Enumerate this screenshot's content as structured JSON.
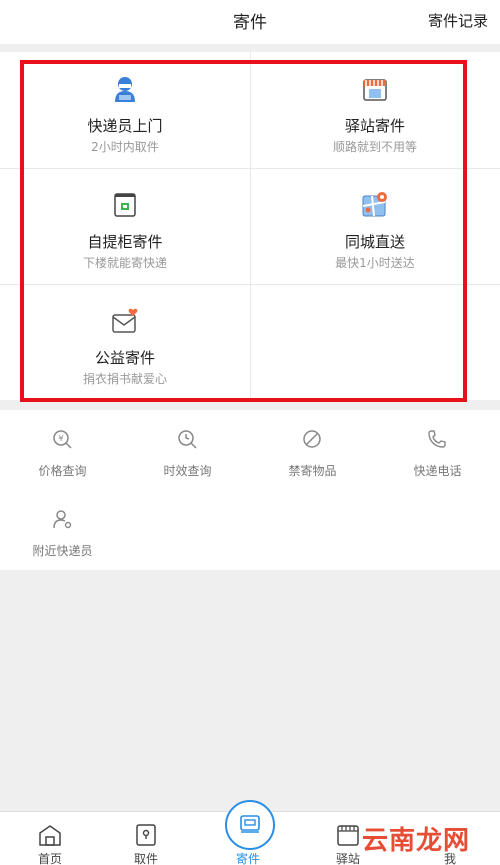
{
  "header": {
    "title": "寄件",
    "record_link": "寄件记录"
  },
  "services": [
    {
      "label": "快递员上门",
      "sub": "2小时内取件",
      "icon": "courier-icon"
    },
    {
      "label": "驿站寄件",
      "sub": "顺路就到不用等",
      "icon": "station-store-icon"
    },
    {
      "label": "自提柜寄件",
      "sub": "下楼就能寄快递",
      "icon": "locker-icon"
    },
    {
      "label": "同城直送",
      "sub": "最快1小时送达",
      "icon": "city-map-icon"
    },
    {
      "label": "公益寄件",
      "sub": "捐衣捐书献爱心",
      "icon": "charity-envelope-icon"
    }
  ],
  "tools": [
    {
      "label": "价格查询",
      "icon": "price-search-icon"
    },
    {
      "label": "时效查询",
      "icon": "clock-search-icon"
    },
    {
      "label": "禁寄物品",
      "icon": "prohibited-icon"
    },
    {
      "label": "快递电话",
      "icon": "phone-icon"
    },
    {
      "label": "附近快递员",
      "icon": "nearby-courier-icon"
    }
  ],
  "tabbar": {
    "items": [
      {
        "label": "首页",
        "icon": "home-icon"
      },
      {
        "label": "取件",
        "icon": "pickup-icon"
      },
      {
        "label": "寄件",
        "icon": "send-icon",
        "active": true
      },
      {
        "label": "驿站",
        "icon": "station-icon"
      },
      {
        "label": "我",
        "icon": "profile-icon"
      }
    ]
  },
  "watermark": "云南龙网",
  "colors": {
    "accent": "#2a8ee6",
    "highlight_box": "#e8101a",
    "watermark": "#e53a1f"
  }
}
